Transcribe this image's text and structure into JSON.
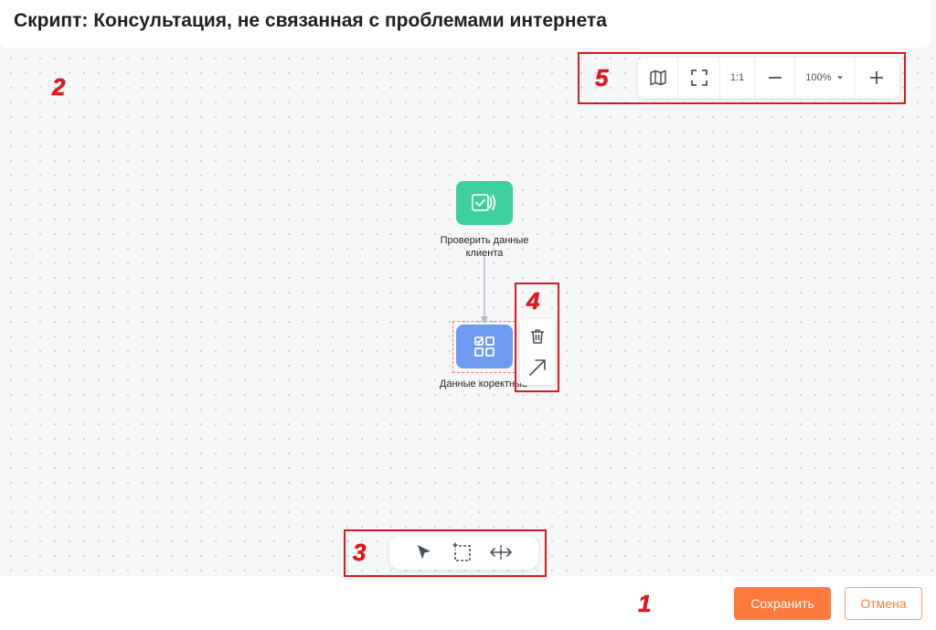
{
  "header": {
    "title": "Скрипт: Консультация, не связанная с проблемами интернета"
  },
  "markers": {
    "m1": "1",
    "m2": "2",
    "m3": "3",
    "m4": "4",
    "m5": "5"
  },
  "zoom_controls": {
    "one_to_one": "1:1",
    "zoom_level": "100%"
  },
  "nodes": [
    {
      "label": "Проверить данные клиента",
      "color": "#3ecf9f",
      "icon": "check-signal-icon"
    },
    {
      "label": "Данные коректные",
      "color": "#6f9af2",
      "icon": "checklist-grid-icon"
    }
  ],
  "toolbar": {
    "tools": [
      "pointer-icon",
      "select-area-icon",
      "pan-horizontal-icon"
    ]
  },
  "context_menu": {
    "items": [
      "trash-icon",
      "arrow-up-right-icon"
    ]
  },
  "footer": {
    "save_label": "Сохранить",
    "cancel_label": "Отмена"
  },
  "colors": {
    "accent": "#ff7a3c",
    "annotation": "#e0161c"
  }
}
